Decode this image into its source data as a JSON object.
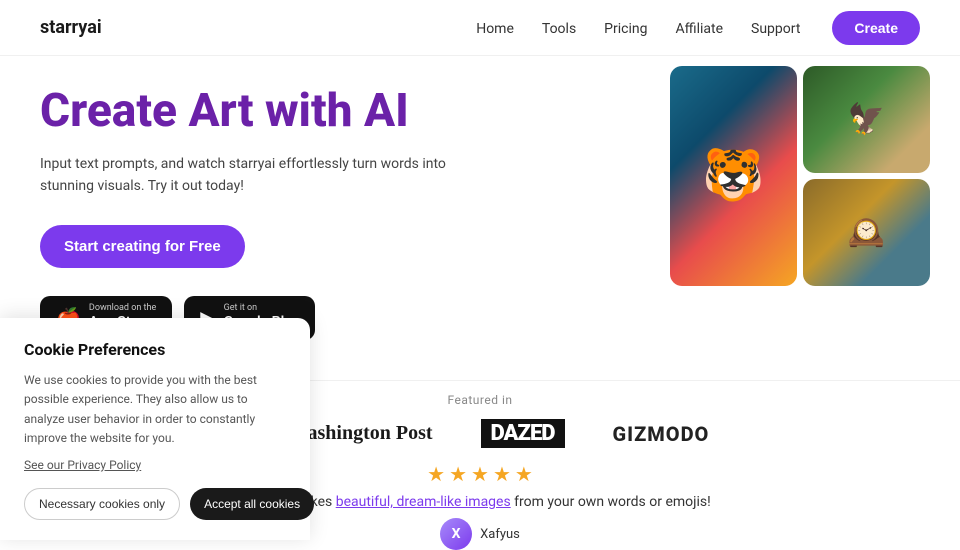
{
  "nav": {
    "logo": "starryai",
    "links": [
      "Home",
      "Tools",
      "Pricing",
      "Affiliate",
      "Support"
    ],
    "create_btn": "Create"
  },
  "hero": {
    "title": "Create Art with AI",
    "description": "Input text prompts, and watch starryai effortlessly turn words into stunning visuals. Try it out today!",
    "cta_btn": "Start creating for Free",
    "app_store": {
      "sub": "Download on the",
      "name": "App Store"
    },
    "google_play": {
      "sub": "Get it on",
      "name": "Google Play"
    }
  },
  "featured": {
    "label": "Featured in",
    "logos": [
      "The Washington Post",
      "DAZED",
      "GIZMODO"
    ],
    "stars": 5,
    "review_text_before": "The ai makes ",
    "review_highlight": "beautiful, dream-like images",
    "review_text_after": " from your own words or emojis!",
    "reviewer_initial": "X"
  },
  "cookie": {
    "title": "Cookie Preferences",
    "description": "We use cookies to provide you with the best possible experience. They also allow us to analyze user behavior in order to constantly improve the website for you.",
    "privacy_link": "See our Privacy Policy",
    "necessary_btn": "Necessary cookies only",
    "accept_btn": "Accept all cookies"
  }
}
